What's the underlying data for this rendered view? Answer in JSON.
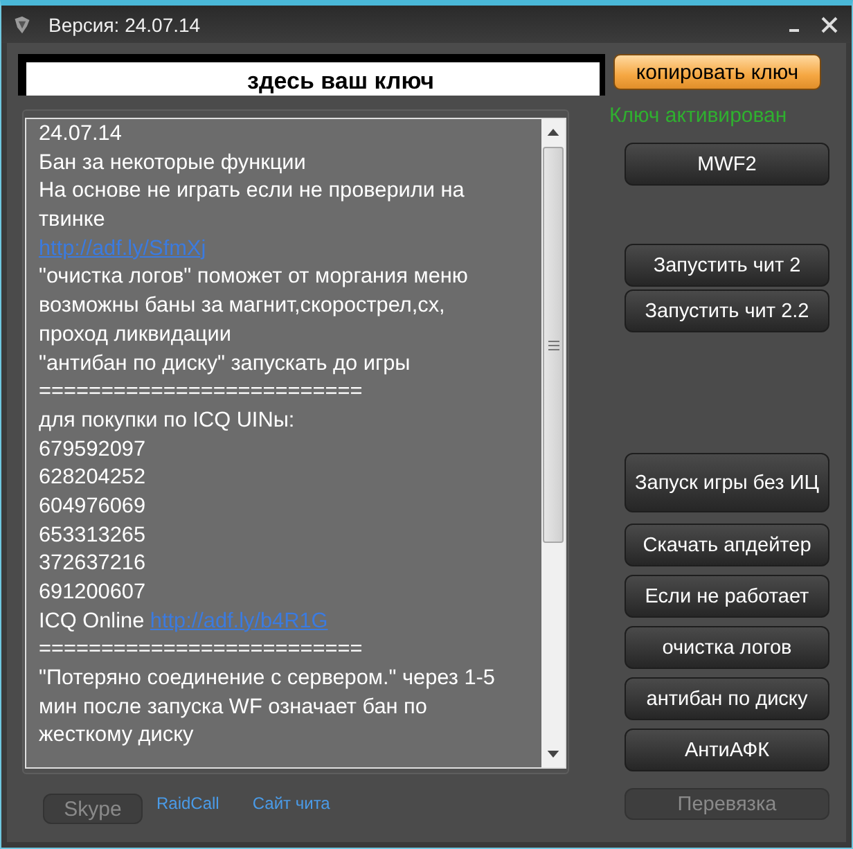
{
  "window": {
    "title": "Версия: 24.07.14"
  },
  "key_field": {
    "value": "здесь ваш ключ"
  },
  "copy_button": {
    "label": "копировать ключ"
  },
  "status": "Ключ активирован",
  "news_lines": [
    {
      "text": "24.07.14"
    },
    {
      "text": "Бан за некоторые функции"
    },
    {
      "text": "На основе не играть если не проверили на"
    },
    {
      "text": "твинке"
    },
    {
      "link": "http://adf.ly/SfmXj"
    },
    {
      "text": "\"очистка логов\" поможет от моргания меню"
    },
    {
      "text": "возможны баны за магнит,скорострел,сх,"
    },
    {
      "text": "проход ликвидации"
    },
    {
      "text": "\"антибан по диску\" запускать до игры"
    },
    {
      "text": "=========================="
    },
    {
      "text": "для покупки по ICQ UINы:"
    },
    {
      "text": "679592097"
    },
    {
      "text": "628204252"
    },
    {
      "text": "604976069"
    },
    {
      "text": "653313265"
    },
    {
      "text": "372637216"
    },
    {
      "text": "691200607"
    },
    {
      "text": "ICQ Online ",
      "link": "http://adf.ly/b4R1G"
    },
    {
      "text": "=========================="
    },
    {
      "text": "\"Потеряно соединение с сервером.\" через 1-5"
    },
    {
      "text": "мин после запуска WF означает бан по"
    },
    {
      "text": "жесткому диску"
    }
  ],
  "buttons": [
    {
      "label": "MWF2",
      "disabled": false
    },
    {
      "label": "Запустить чит 2",
      "disabled": false
    },
    {
      "label": "Запустить чит 2.2",
      "disabled": false
    },
    {
      "label": "Запуск игры без ИЦ",
      "disabled": false
    },
    {
      "label": "Скачать апдейтер",
      "disabled": false
    },
    {
      "label": "Если не работает",
      "disabled": false
    },
    {
      "label": "очистка логов",
      "disabled": false
    },
    {
      "label": "антибан по диску",
      "disabled": false
    },
    {
      "label": "АнтиАФК",
      "disabled": false
    },
    {
      "label": "Перевязка",
      "disabled": true
    }
  ],
  "footer": {
    "skype_button": {
      "label": "Skype",
      "disabled": true
    },
    "links": [
      "RaidCall",
      "Сайт чита"
    ]
  }
}
